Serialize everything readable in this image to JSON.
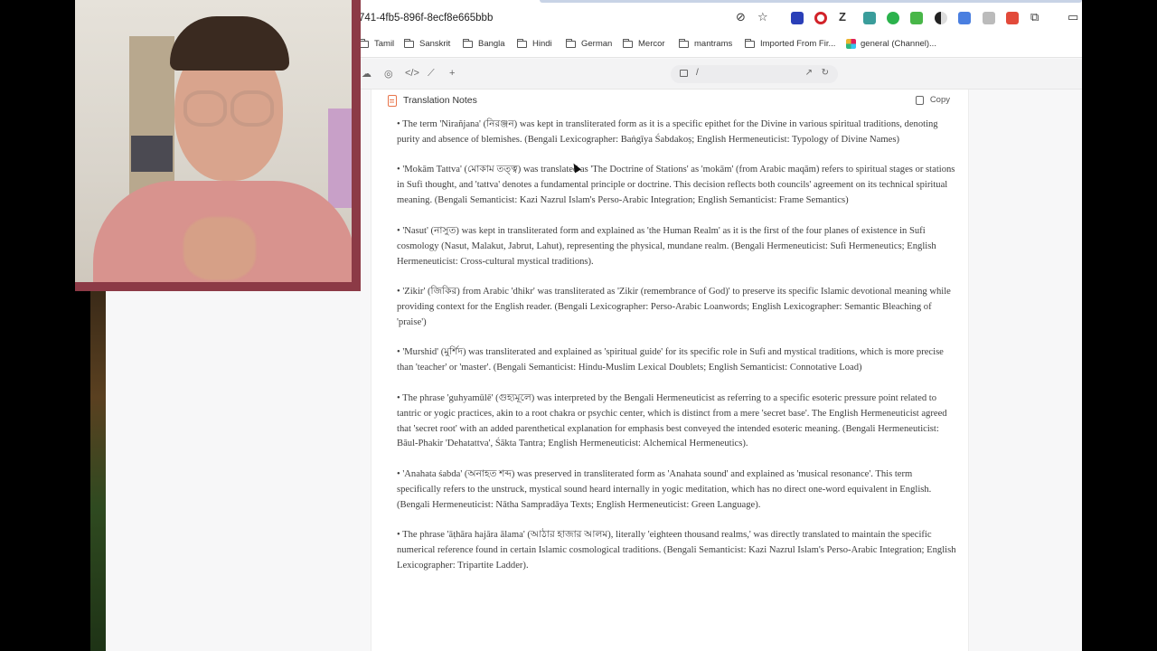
{
  "address_bar": {
    "url": "741-4fb5-896f-8ecf8e665bbb"
  },
  "bookmarks": [
    {
      "label": "Tamil"
    },
    {
      "label": "Sanskrit"
    },
    {
      "label": "Bangla"
    },
    {
      "label": "Hindi"
    },
    {
      "label": "German"
    },
    {
      "label": "Mercor"
    },
    {
      "label": "mantrams"
    },
    {
      "label": "Imported From Fir..."
    },
    {
      "label": "general (Channel)..."
    }
  ],
  "toolbar": {
    "path": "/",
    "add_label": "+"
  },
  "card": {
    "title": "Translation Notes",
    "copy_label": "Copy"
  },
  "notes": [
    "• The term 'Nirañjana' (নিরঞ্জন) was kept in transliterated form as it is a specific epithet for the Divine in various spiritual traditions, denoting purity and absence of blemishes. (Bengali Lexicographer: Baṅgīya Śabdakoṣ; English Hermeneuticist: Typology of Divine Names)",
    "• 'Mokām Tattva' (মোকাম তত্ত্ব) was translated as 'The Doctrine of Stations' as 'mokām' (from Arabic maqām) refers to spiritual stages or stations in Sufi thought, and 'tattva' denotes a fundamental principle or doctrine. This decision reflects both councils' agreement on its technical spiritual meaning. (Bengali Semanticist: Kazi Nazrul Islam's Perso-Arabic Integration; English Semanticist: Frame Semantics)",
    "• 'Nasut' (নাসুত) was kept in transliterated form and explained as 'the Human Realm' as it is the first of the four planes of existence in Sufi cosmology (Nasut, Malakut, Jabrut, Lahut), representing the physical, mundane realm. (Bengali Hermeneuticist: Sufi Hermeneutics; English Hermeneuticist: Cross-cultural mystical traditions).",
    "• 'Zikir' (জিকির) from Arabic 'dhikr' was transliterated as 'Zikir (remembrance of God)' to preserve its specific Islamic devotional meaning while providing context for the English reader. (Bengali Lexicographer: Perso-Arabic Loanwords; English Lexicographer: Semantic Bleaching of 'praise')",
    "• 'Murshid' (মুর্শিদ) was transliterated and explained as 'spiritual guide' for its specific role in Sufi and mystical traditions, which is more precise than 'teacher' or 'master'. (Bengali Semanticist: Hindu-Muslim Lexical Doublets; English Semanticist: Connotative Load)",
    "• The phrase 'guhyamūlē' (গুহ্যমূলে) was interpreted by the Bengali Hermeneuticist as referring to a specific esoteric pressure point related to tantric or yogic practices, akin to a root chakra or psychic center, which is distinct from a mere 'secret base'. The English Hermeneuticist agreed that 'secret root' with an added parenthetical explanation for emphasis best conveyed the intended esoteric meaning. (Bengali Hermeneuticist: Bāul-Phakir 'Dehatattva', Śākta Tantra; English Hermeneuticist: Alchemical Hermeneutics).",
    "• 'Anahata śabda' (অনাহত শব্দ) was preserved in transliterated form as 'Anahata sound' and explained as 'musical resonance'. This term specifically refers to the unstruck, mystical sound heard internally in yogic meditation, which has no direct one-word equivalent in English. (Bengali Hermeneuticist: Nātha Sampradāya Texts; English Hermeneuticist: Green Language).",
    "• The phrase 'āṭhāra hajāra ālama' (আঠার হাজার আলম), literally 'eighteen thousand realms,' was directly translated to maintain the specific numerical reference found in certain Islamic cosmological traditions. (Bengali Semanticist: Kazi Nazrul Islam's Perso-Arabic Integration; English Lexicographer: Tripartite Ladder)."
  ]
}
